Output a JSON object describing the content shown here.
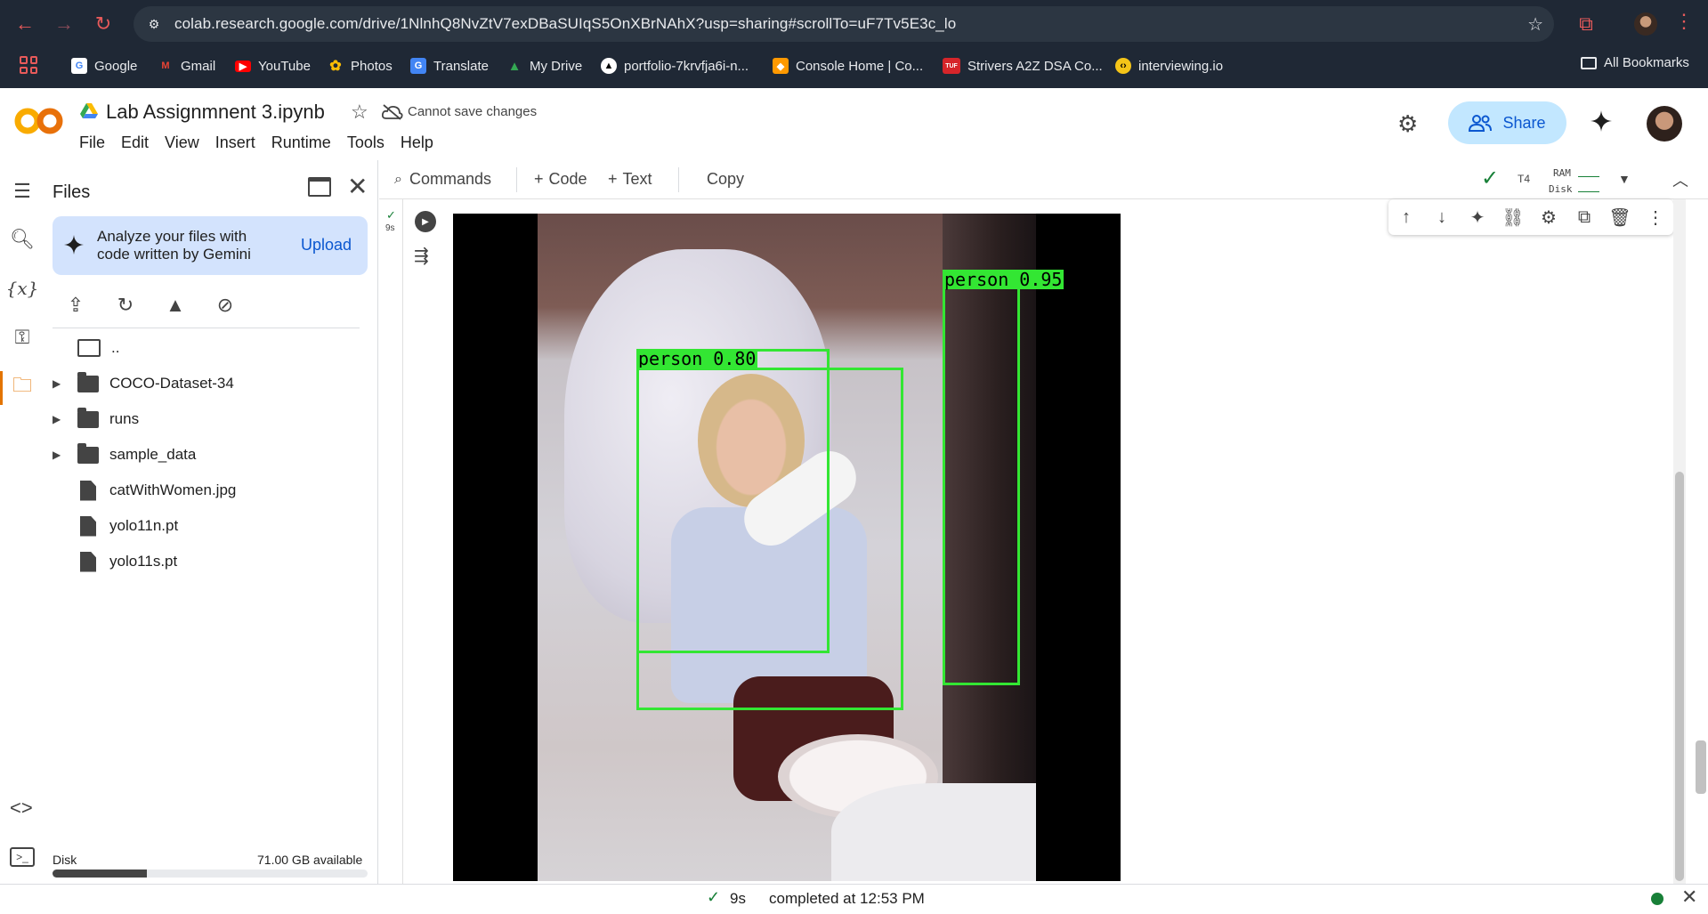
{
  "browser": {
    "url": "colab.research.google.com/drive/1NlnhQ8NvZtV7exDBaSUIqS5OnXBrNAhX?usp=sharing#scrollTo=uF7Tv5E3c_lo",
    "bookmarks": [
      {
        "label": "Google",
        "color": "#4285f4",
        "glyph": "G"
      },
      {
        "label": "Gmail",
        "color": "#ea4335",
        "glyph": "M"
      },
      {
        "label": "YouTube",
        "color": "#ff0000",
        "glyph": "▶"
      },
      {
        "label": "Photos",
        "color": "#fbbc04",
        "glyph": "✿"
      },
      {
        "label": "Translate",
        "color": "#4285f4",
        "glyph": "G"
      },
      {
        "label": "My Drive",
        "color": "#34a853",
        "glyph": "▲"
      },
      {
        "label": "portfolio-7krvfja6i-n...",
        "color": "#000000",
        "glyph": "▲"
      },
      {
        "label": "Console Home | Co...",
        "color": "#ff9900",
        "glyph": "◆"
      },
      {
        "label": "Strivers A2Z DSA Co...",
        "color": "#d6252a",
        "glyph": "TUF"
      },
      {
        "label": "interviewing.io",
        "color": "#f5c518",
        "glyph": "‹›"
      }
    ],
    "all_bookmarks": "All Bookmarks"
  },
  "header": {
    "title": "Lab Assignmnent 3.ipynb",
    "cannot_save": "Cannot save changes",
    "menu": [
      "File",
      "Edit",
      "View",
      "Insert",
      "Runtime",
      "Tools",
      "Help"
    ],
    "share_label": "Share"
  },
  "files_panel": {
    "title": "Files",
    "gemini_text": "Analyze your files with code written by Gemini",
    "upload_label": "Upload",
    "items": [
      {
        "name": "..",
        "kind": "parent"
      },
      {
        "name": "COCO-Dataset-34",
        "kind": "folder"
      },
      {
        "name": "runs",
        "kind": "folder"
      },
      {
        "name": "sample_data",
        "kind": "folder"
      },
      {
        "name": "catWithWomen.jpg",
        "kind": "file"
      },
      {
        "name": "yolo11n.pt",
        "kind": "file"
      },
      {
        "name": "yolo11s.pt",
        "kind": "file"
      }
    ],
    "disk_label": "Disk",
    "disk_available": "71.00 GB available",
    "disk_used_fraction": 0.3
  },
  "toolbar": {
    "commands": "Commands",
    "code": "Code",
    "text": "Text",
    "copy": "Copy",
    "runtime_type": "T4",
    "ram_label": "RAM",
    "disk_label": "Disk"
  },
  "cell": {
    "exec_time": "9s"
  },
  "detections": [
    {
      "label": "person 0.95"
    },
    {
      "label": "person 0.80"
    }
  ],
  "status": {
    "time": "9s",
    "text": "completed at 12:53 PM"
  },
  "colors": {
    "accent": "#0b57d0",
    "share_bg": "#c2e7ff",
    "detection_box": "#33e633",
    "success": "#188038"
  }
}
